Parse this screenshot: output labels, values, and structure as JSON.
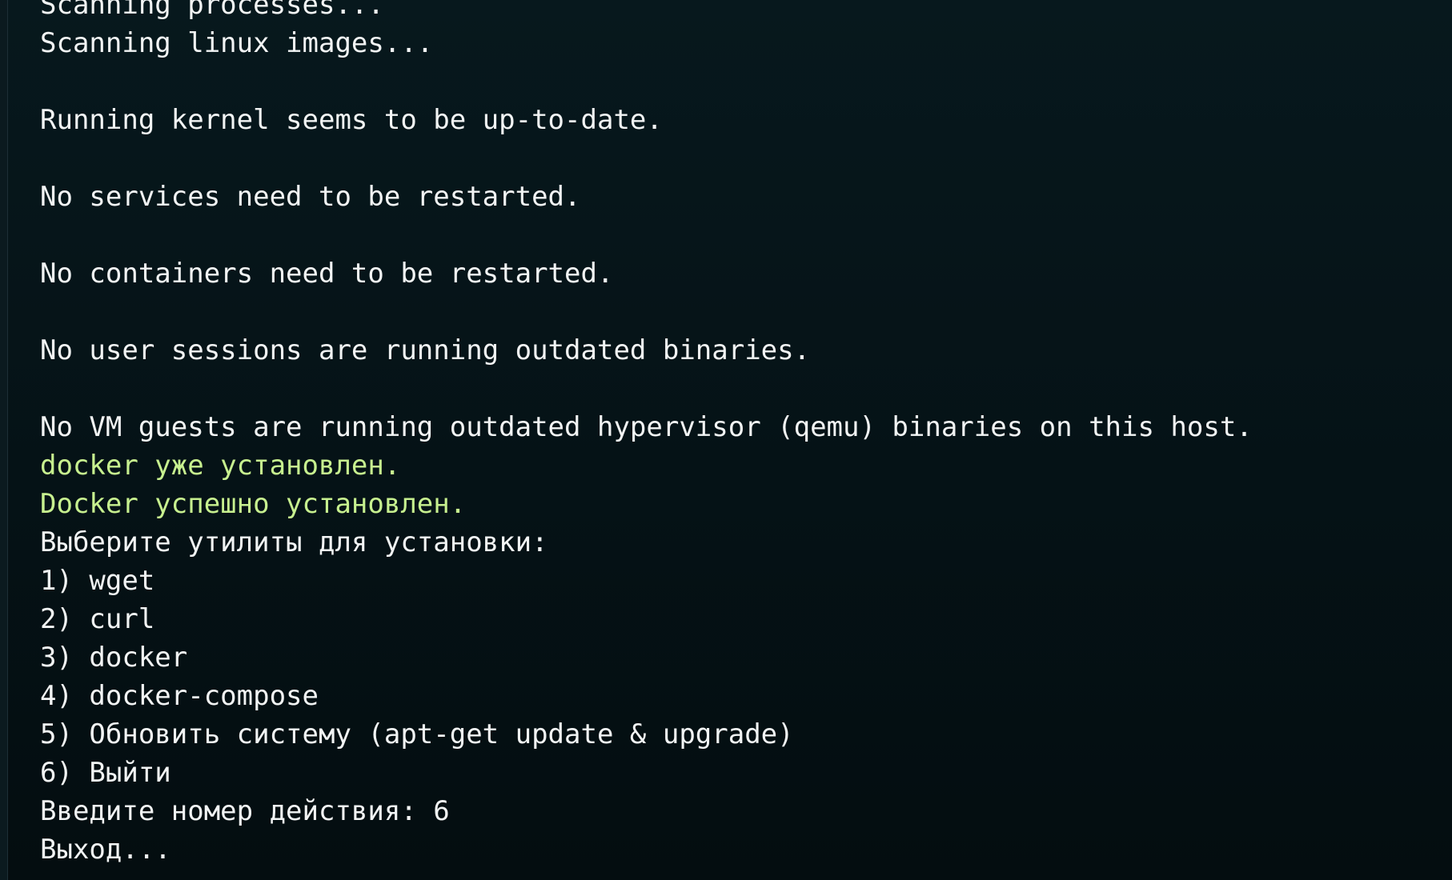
{
  "terminal": {
    "colors": {
      "background": "#061418",
      "text": "#f2f4f4",
      "success": "#c7f08f"
    },
    "lines": [
      {
        "text": "Scanning processes...",
        "type": "normal"
      },
      {
        "text": "Scanning linux images...",
        "type": "normal"
      },
      {
        "text": "",
        "type": "blank"
      },
      {
        "text": "Running kernel seems to be up-to-date.",
        "type": "normal"
      },
      {
        "text": "",
        "type": "blank"
      },
      {
        "text": "No services need to be restarted.",
        "type": "normal"
      },
      {
        "text": "",
        "type": "blank"
      },
      {
        "text": "No containers need to be restarted.",
        "type": "normal"
      },
      {
        "text": "",
        "type": "blank"
      },
      {
        "text": "No user sessions are running outdated binaries.",
        "type": "normal"
      },
      {
        "text": "",
        "type": "blank"
      },
      {
        "text": "No VM guests are running outdated hypervisor (qemu) binaries on this host.",
        "type": "normal"
      },
      {
        "text": "docker уже установлен.",
        "type": "success"
      },
      {
        "text": "Docker успешно установлен.",
        "type": "success"
      },
      {
        "text": "Выберите утилиты для установки:",
        "type": "normal"
      },
      {
        "text": "1) wget",
        "type": "normal"
      },
      {
        "text": "2) curl",
        "type": "normal"
      },
      {
        "text": "3) docker",
        "type": "normal"
      },
      {
        "text": "4) docker-compose",
        "type": "normal"
      },
      {
        "text": "5) Обновить систему (apt-get update & upgrade)",
        "type": "normal"
      },
      {
        "text": "6) Выйти",
        "type": "normal"
      },
      {
        "text": "Введите номер действия: 6",
        "type": "normal"
      },
      {
        "text": "Выход...",
        "type": "normal"
      }
    ]
  }
}
